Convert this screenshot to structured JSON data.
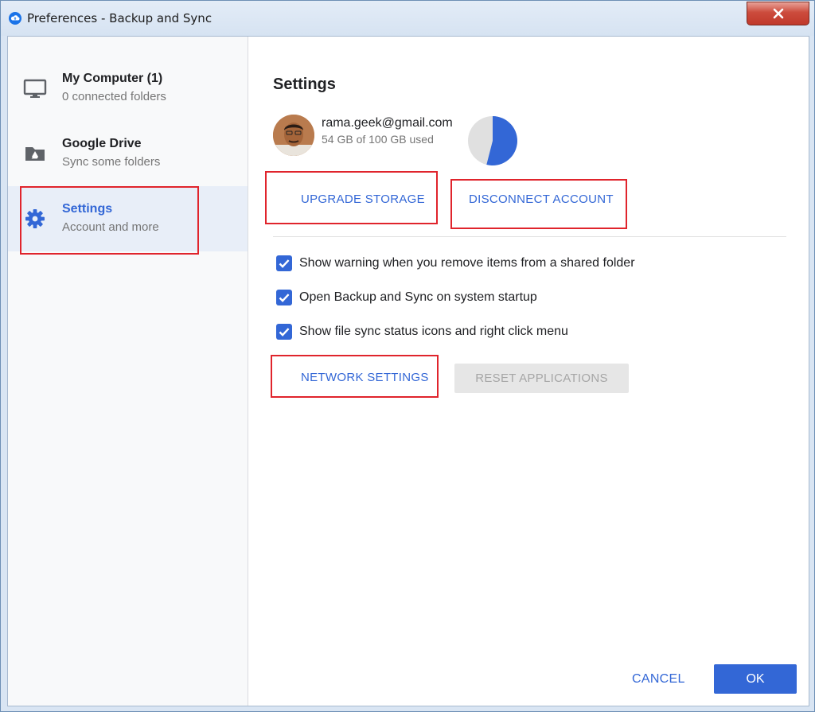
{
  "window": {
    "title": "Preferences - Backup and Sync"
  },
  "sidebar": {
    "items": [
      {
        "title": "My Computer (1)",
        "subtitle": "0 connected folders",
        "icon": "monitor-icon",
        "active": false
      },
      {
        "title": "Google Drive",
        "subtitle": "Sync some folders",
        "icon": "drive-folder-icon",
        "active": false
      },
      {
        "title": "Settings",
        "subtitle": "Account and more",
        "icon": "gear-icon",
        "active": true
      }
    ]
  },
  "settings": {
    "heading": "Settings",
    "account": {
      "email": "rama.geek@gmail.com",
      "usage": "54 GB of 100 GB used",
      "used_gb": 54,
      "total_gb": 100
    },
    "buttons": {
      "upgrade": "UPGRADE STORAGE",
      "disconnect": "DISCONNECT ACCOUNT",
      "network": "NETWORK SETTINGS",
      "reset": "RESET APPLICATIONS"
    },
    "options": [
      {
        "label": "Show warning when you remove items from a shared folder",
        "checked": true
      },
      {
        "label": "Open Backup and Sync on system startup",
        "checked": true
      },
      {
        "label": "Show file sync status icons and right click menu",
        "checked": true
      }
    ]
  },
  "footer": {
    "cancel": "CANCEL",
    "ok": "OK"
  },
  "colors": {
    "accent": "#3367d6",
    "highlight": "#e0242c",
    "pie_remaining": "#e0e0e0"
  }
}
